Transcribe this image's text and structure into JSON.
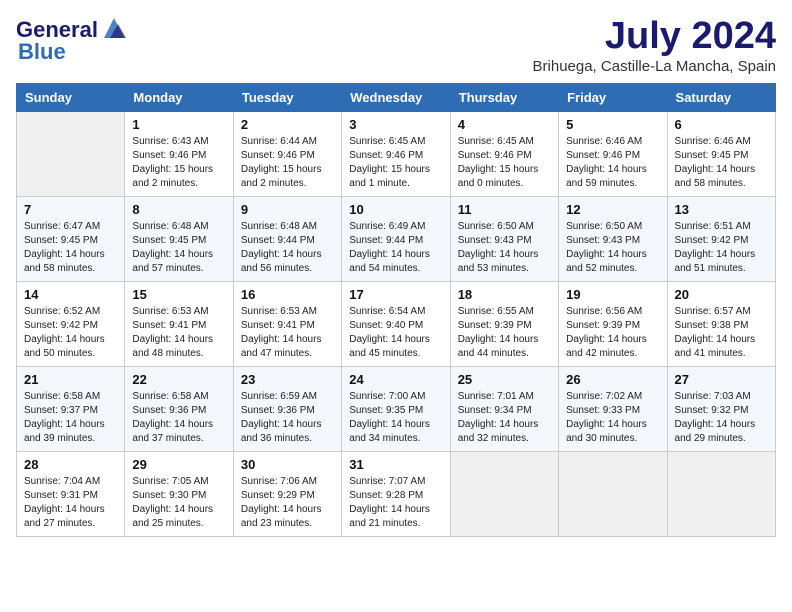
{
  "header": {
    "logo_line1": "General",
    "logo_line2": "Blue",
    "month_title": "July 2024",
    "location": "Brihuega, Castille-La Mancha, Spain"
  },
  "days_of_week": [
    "Sunday",
    "Monday",
    "Tuesday",
    "Wednesday",
    "Thursday",
    "Friday",
    "Saturday"
  ],
  "weeks": [
    [
      {
        "day": "",
        "info": ""
      },
      {
        "day": "1",
        "info": "Sunrise: 6:43 AM\nSunset: 9:46 PM\nDaylight: 15 hours\nand 2 minutes."
      },
      {
        "day": "2",
        "info": "Sunrise: 6:44 AM\nSunset: 9:46 PM\nDaylight: 15 hours\nand 2 minutes."
      },
      {
        "day": "3",
        "info": "Sunrise: 6:45 AM\nSunset: 9:46 PM\nDaylight: 15 hours\nand 1 minute."
      },
      {
        "day": "4",
        "info": "Sunrise: 6:45 AM\nSunset: 9:46 PM\nDaylight: 15 hours\nand 0 minutes."
      },
      {
        "day": "5",
        "info": "Sunrise: 6:46 AM\nSunset: 9:46 PM\nDaylight: 14 hours\nand 59 minutes."
      },
      {
        "day": "6",
        "info": "Sunrise: 6:46 AM\nSunset: 9:45 PM\nDaylight: 14 hours\nand 58 minutes."
      }
    ],
    [
      {
        "day": "7",
        "info": "Sunrise: 6:47 AM\nSunset: 9:45 PM\nDaylight: 14 hours\nand 58 minutes."
      },
      {
        "day": "8",
        "info": "Sunrise: 6:48 AM\nSunset: 9:45 PM\nDaylight: 14 hours\nand 57 minutes."
      },
      {
        "day": "9",
        "info": "Sunrise: 6:48 AM\nSunset: 9:44 PM\nDaylight: 14 hours\nand 56 minutes."
      },
      {
        "day": "10",
        "info": "Sunrise: 6:49 AM\nSunset: 9:44 PM\nDaylight: 14 hours\nand 54 minutes."
      },
      {
        "day": "11",
        "info": "Sunrise: 6:50 AM\nSunset: 9:43 PM\nDaylight: 14 hours\nand 53 minutes."
      },
      {
        "day": "12",
        "info": "Sunrise: 6:50 AM\nSunset: 9:43 PM\nDaylight: 14 hours\nand 52 minutes."
      },
      {
        "day": "13",
        "info": "Sunrise: 6:51 AM\nSunset: 9:42 PM\nDaylight: 14 hours\nand 51 minutes."
      }
    ],
    [
      {
        "day": "14",
        "info": "Sunrise: 6:52 AM\nSunset: 9:42 PM\nDaylight: 14 hours\nand 50 minutes."
      },
      {
        "day": "15",
        "info": "Sunrise: 6:53 AM\nSunset: 9:41 PM\nDaylight: 14 hours\nand 48 minutes."
      },
      {
        "day": "16",
        "info": "Sunrise: 6:53 AM\nSunset: 9:41 PM\nDaylight: 14 hours\nand 47 minutes."
      },
      {
        "day": "17",
        "info": "Sunrise: 6:54 AM\nSunset: 9:40 PM\nDaylight: 14 hours\nand 45 minutes."
      },
      {
        "day": "18",
        "info": "Sunrise: 6:55 AM\nSunset: 9:39 PM\nDaylight: 14 hours\nand 44 minutes."
      },
      {
        "day": "19",
        "info": "Sunrise: 6:56 AM\nSunset: 9:39 PM\nDaylight: 14 hours\nand 42 minutes."
      },
      {
        "day": "20",
        "info": "Sunrise: 6:57 AM\nSunset: 9:38 PM\nDaylight: 14 hours\nand 41 minutes."
      }
    ],
    [
      {
        "day": "21",
        "info": "Sunrise: 6:58 AM\nSunset: 9:37 PM\nDaylight: 14 hours\nand 39 minutes."
      },
      {
        "day": "22",
        "info": "Sunrise: 6:58 AM\nSunset: 9:36 PM\nDaylight: 14 hours\nand 37 minutes."
      },
      {
        "day": "23",
        "info": "Sunrise: 6:59 AM\nSunset: 9:36 PM\nDaylight: 14 hours\nand 36 minutes."
      },
      {
        "day": "24",
        "info": "Sunrise: 7:00 AM\nSunset: 9:35 PM\nDaylight: 14 hours\nand 34 minutes."
      },
      {
        "day": "25",
        "info": "Sunrise: 7:01 AM\nSunset: 9:34 PM\nDaylight: 14 hours\nand 32 minutes."
      },
      {
        "day": "26",
        "info": "Sunrise: 7:02 AM\nSunset: 9:33 PM\nDaylight: 14 hours\nand 30 minutes."
      },
      {
        "day": "27",
        "info": "Sunrise: 7:03 AM\nSunset: 9:32 PM\nDaylight: 14 hours\nand 29 minutes."
      }
    ],
    [
      {
        "day": "28",
        "info": "Sunrise: 7:04 AM\nSunset: 9:31 PM\nDaylight: 14 hours\nand 27 minutes."
      },
      {
        "day": "29",
        "info": "Sunrise: 7:05 AM\nSunset: 9:30 PM\nDaylight: 14 hours\nand 25 minutes."
      },
      {
        "day": "30",
        "info": "Sunrise: 7:06 AM\nSunset: 9:29 PM\nDaylight: 14 hours\nand 23 minutes."
      },
      {
        "day": "31",
        "info": "Sunrise: 7:07 AM\nSunset: 9:28 PM\nDaylight: 14 hours\nand 21 minutes."
      },
      {
        "day": "",
        "info": ""
      },
      {
        "day": "",
        "info": ""
      },
      {
        "day": "",
        "info": ""
      }
    ]
  ]
}
